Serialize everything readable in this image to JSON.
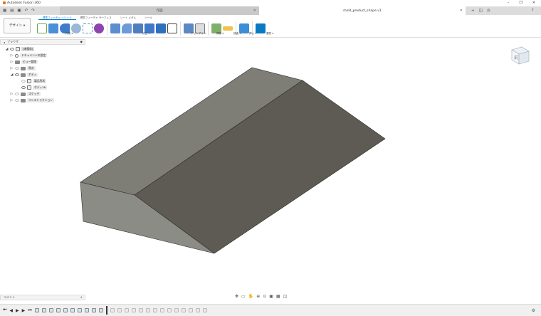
{
  "titlebar": {
    "app_title": "Autodesk Fusion 360"
  },
  "tabs": {
    "inactive_label": "作図",
    "active_label": "mold_product_shape v1"
  },
  "workspace": {
    "label": "デザイン"
  },
  "ribbon": {
    "tabs": [
      "ソリッド",
      "サーフェス",
      "シート メタル",
      "ツール"
    ],
    "active_tab_prefix": "標準フィーチャ",
    "tab_prefixes": [
      "標準フィーチャ",
      "標準フィーチャ",
      "",
      ""
    ],
    "groups": [
      "作成",
      "修正",
      "アセンブリ",
      "構築",
      "検査",
      "挿入",
      "選択"
    ]
  },
  "browser": {
    "title": "ブラウザ",
    "root": "(未保存)",
    "items": [
      {
        "label": "ドキュメントの設定"
      },
      {
        "label": "ビュー管理"
      },
      {
        "label": "原点"
      },
      {
        "label": "ボディ"
      },
      {
        "label": "製品形状"
      },
      {
        "label": "ボディ16"
      },
      {
        "label": "スケッチ"
      },
      {
        "label": "コンストラクション"
      }
    ]
  },
  "comments": {
    "title": "コメント"
  },
  "viewcube": {
    "face_label": "前"
  },
  "colors": {
    "accent": "#0b78c2",
    "solid_top": "#7e7e77",
    "solid_slope": "#5e5b54",
    "solid_front": "#8c8c86"
  }
}
